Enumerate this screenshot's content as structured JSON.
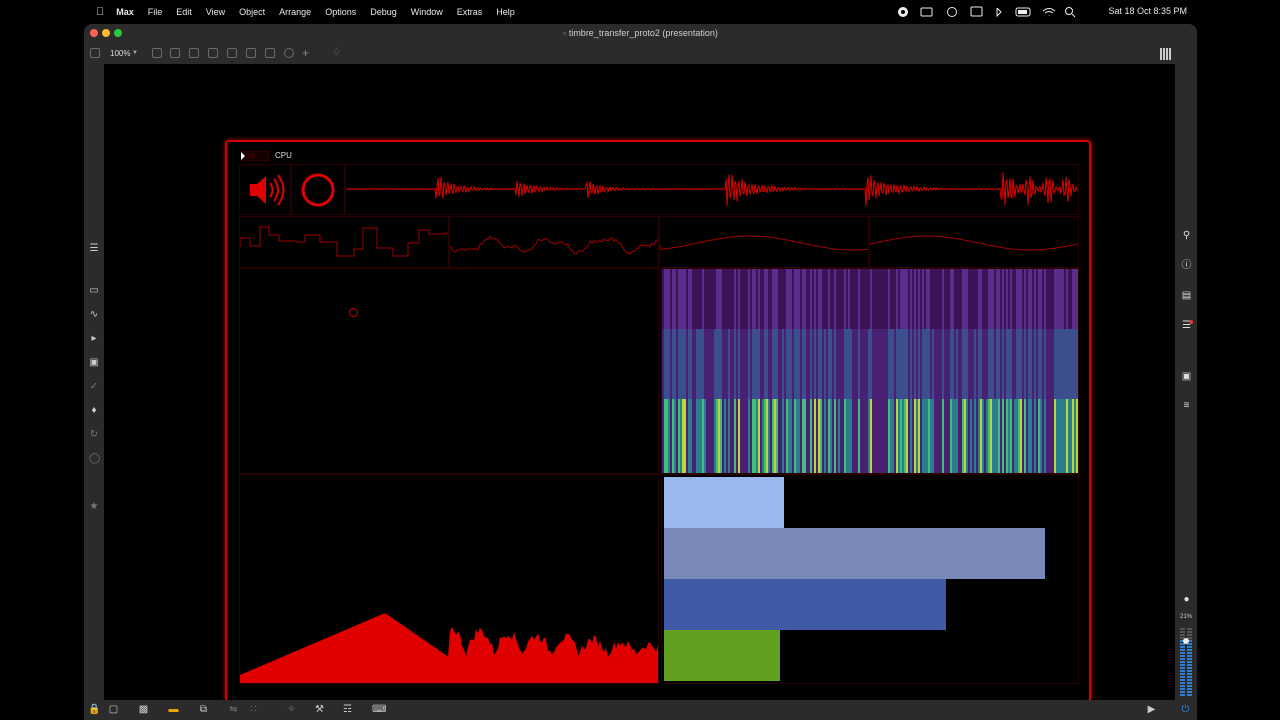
{
  "menubar": {
    "apple_icon": "apple-icon",
    "app_name": "Max",
    "items": [
      "File",
      "Edit",
      "View",
      "Object",
      "Arrange",
      "Options",
      "Debug",
      "Window",
      "Extras",
      "Help"
    ],
    "status_icons": [
      "record-icon",
      "display-icon",
      "time-machine-icon",
      "screen-icon",
      "bluetooth-icon",
      "battery-icon",
      "wifi-icon",
      "search-icon",
      "control-center-icon",
      "siri-icon"
    ],
    "clock": "Sat 18 Oct  8:35 PM"
  },
  "window": {
    "title": "timbre_transfer_proto2 (presentation)",
    "zoom": "100%",
    "traffic_lights": {
      "close": "#ff5f57",
      "minimize": "#febc2e",
      "zoom": "#28c840"
    }
  },
  "patch": {
    "cpu_label": "CPU",
    "cpu_value": "23",
    "accent": "#d40000",
    "osc_shapes": [
      "square-random",
      "smooth-random",
      "sine-slow",
      "sine-slow-2"
    ],
    "bars": [
      {
        "color": "#9ab8ec",
        "fraction": 0.29
      },
      {
        "color": "#7a88b8",
        "fraction": 0.92
      },
      {
        "color": "#415aa8",
        "fraction": 0.68
      },
      {
        "color": "#62a11f",
        "fraction": 0.28
      }
    ]
  },
  "right_sidebar": {
    "icons": [
      "search-icon",
      "info-icon",
      "reference-icon",
      "list-icon",
      "snapshot-icon",
      "mixer-icon",
      "dsp-icon"
    ],
    "cpu_percent": "21%"
  },
  "left_sidebar": {
    "icons": [
      "menu-icon",
      "object-icon",
      "audio-icon",
      "step-icon",
      "image-icon",
      "clip-icon",
      "plugin-icon",
      "loop-icon",
      "package-icon",
      "favorite-icon"
    ]
  },
  "bottom_bar": {
    "icons": [
      "lock-icon",
      "presentation-icon",
      "view-icon",
      "comment-icon",
      "window-icon",
      "toggle-icon",
      "grid-icon",
      "debug-icon",
      "wrench-icon",
      "piano-icon",
      "keyboard-icon"
    ],
    "right_icons": [
      "transport-icon",
      "power-icon"
    ]
  }
}
